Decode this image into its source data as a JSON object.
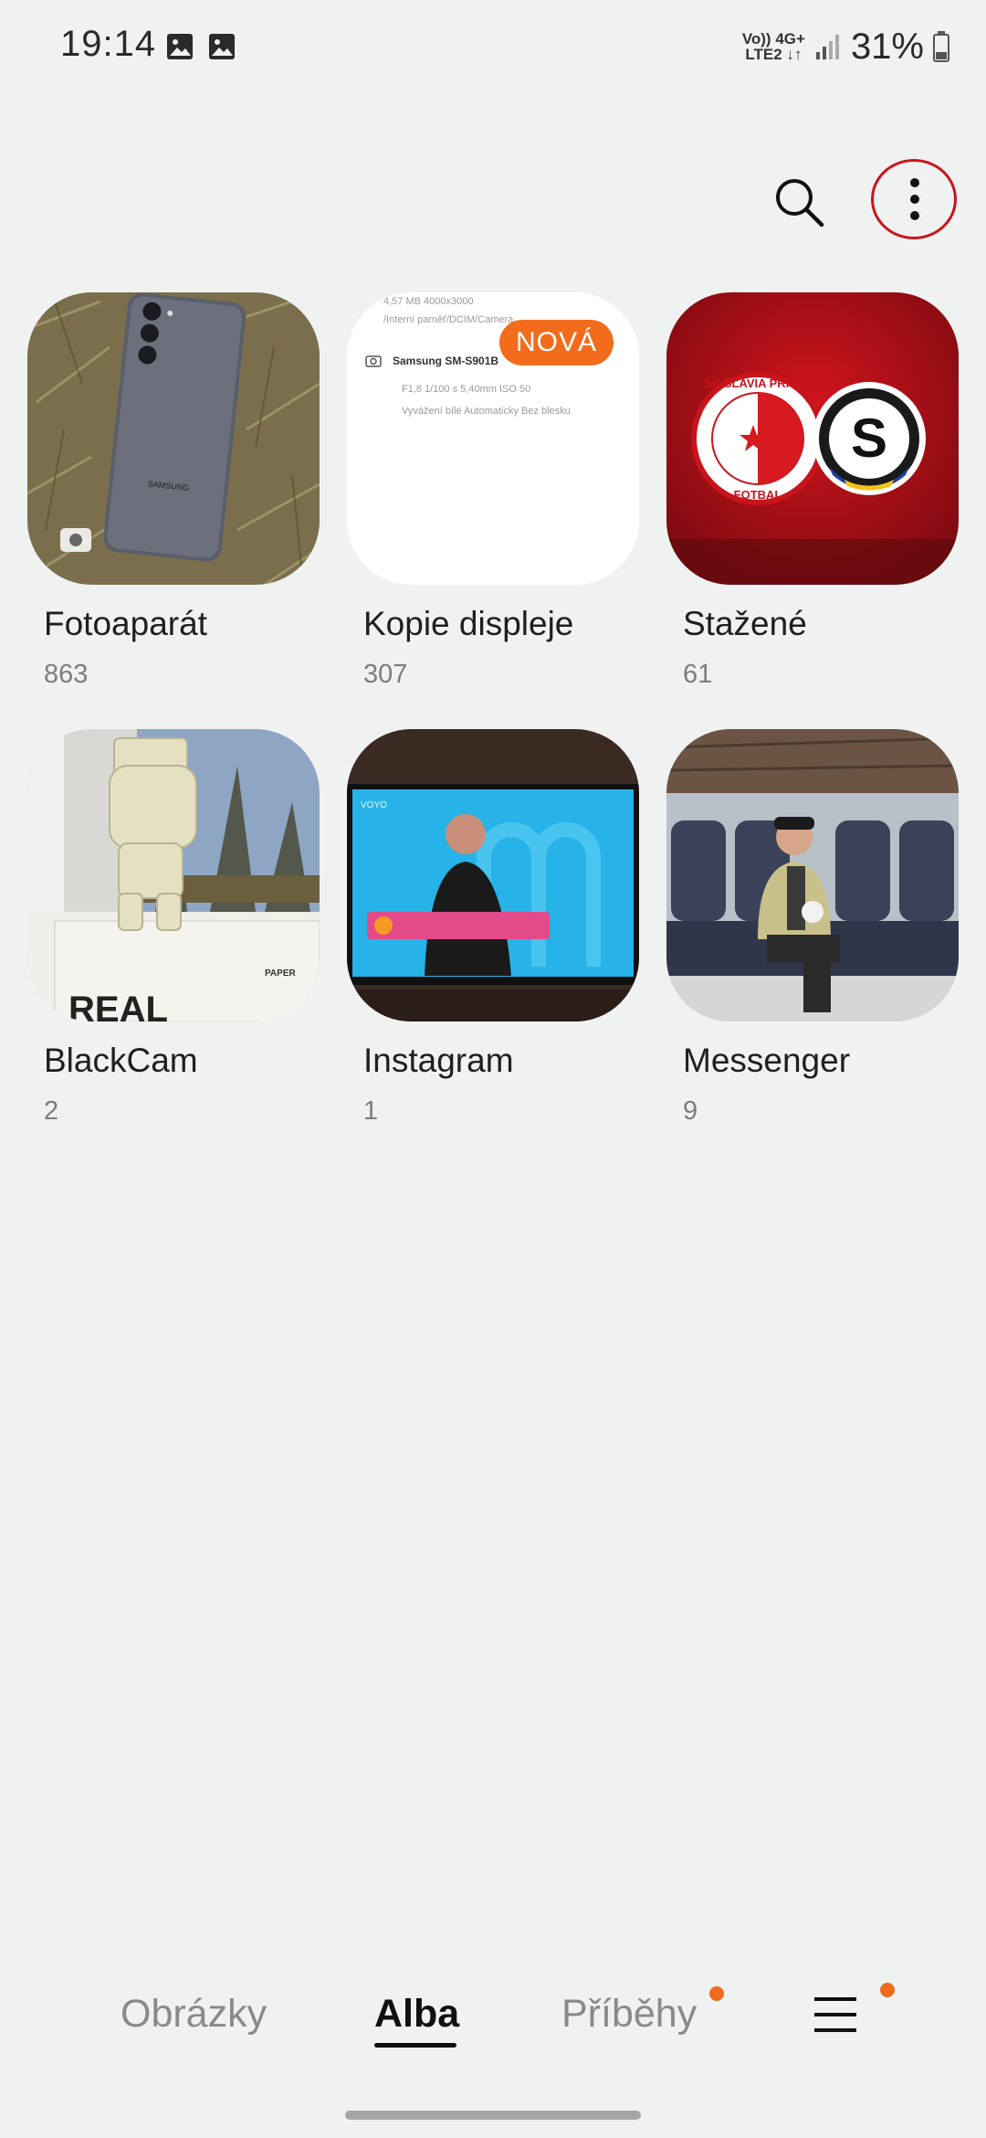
{
  "status_bar": {
    "time": "19:14",
    "network_top": "Vo)) 4G+",
    "network_bottom": "LTE2 ↓↑",
    "battery": "31%"
  },
  "albums": [
    {
      "name": "Fotoaparát",
      "count": "863"
    },
    {
      "name": "Kopie displeje",
      "count": "307",
      "badge": "NOVÁ",
      "preview_lines": [
        "4,57 MB   4000x3000",
        "/Interní paměť/DCIM/Camera",
        "Samsung SM-S901B",
        "F1,8    1/100 s    5,40mm    ISO 50",
        "Vyvážení bílé Automaticky    Bez blesku"
      ]
    },
    {
      "name": "Stažené",
      "count": "61"
    },
    {
      "name": "BlackCam",
      "count": "2"
    },
    {
      "name": "Instagram",
      "count": "1"
    },
    {
      "name": "Messenger",
      "count": "9"
    }
  ],
  "thumb_labels": {
    "phone_brand": "SAMSUNG",
    "slavia_crest_text": "SK SLAVIA PRAHA",
    "slavia_sub": "FOTBAL",
    "sparta_letter": "S",
    "box_label": "PAPER",
    "box_brand": "REAL",
    "tv_channel": "VOYO"
  },
  "nav": {
    "tabs": [
      "Obrázky",
      "Alba",
      "Příběhy"
    ],
    "active": "Alba"
  },
  "colors": {
    "background": "#eff2f1",
    "accent_badge": "#f26c1b",
    "highlight_circle": "#c9151e"
  }
}
